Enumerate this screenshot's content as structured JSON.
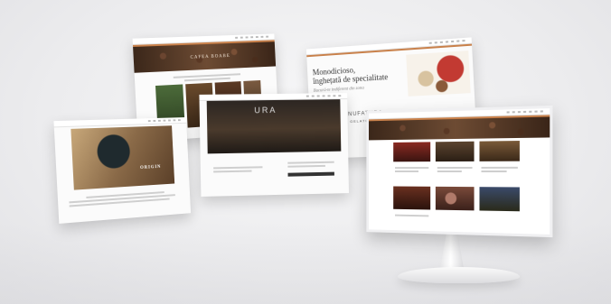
{
  "panels": {
    "coffee_beans": {
      "hero_label": "CAFEA BOABE"
    },
    "gelato": {
      "headline_line1": "Monodicioso,",
      "headline_line2": "înghețată de specialitate",
      "tagline": "Bucură-te indiferent din zona",
      "brand_line1": "MANUFATURA",
      "brand_line2": "DEL GELATO"
    },
    "store": {
      "sign": "URA"
    },
    "coffee_origin": {
      "hero_label": "ORIGIN"
    }
  },
  "colors": {
    "accent": "#c9814b",
    "coffee_dark": "#3b271a",
    "background": "#ececee"
  }
}
